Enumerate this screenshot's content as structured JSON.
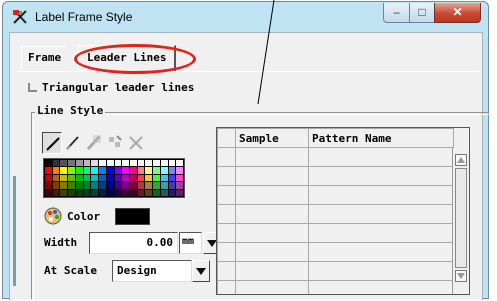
{
  "window": {
    "title": "Label Frame Style",
    "controls": {
      "minimize": "–",
      "maximize": "□",
      "close": "✕"
    }
  },
  "tabs": [
    {
      "label": "Frame"
    },
    {
      "label": "Leader Lines",
      "active": true
    }
  ],
  "options": {
    "triangular_leader_lines": {
      "label": "Triangular leader lines",
      "checked": false
    }
  },
  "line_style": {
    "legend": "Line Style",
    "tools": [
      "solid-line-icon",
      "pen-line-icon",
      "pattern-fill-icon",
      "symbol-line-icon",
      "none-icon"
    ],
    "palette": [
      [
        "#000000",
        "#333333",
        "#555555",
        "#777777",
        "#999999",
        "#bbbbbb",
        "#dddddd",
        "#ffffff",
        "#ffffff",
        "#ffffff",
        "#ffffff",
        "#ffffff",
        "#ffffff",
        "#ffffff",
        "#ffffff",
        "#ffffff",
        "#ffffff",
        "#ffffff"
      ],
      [
        "#ff0000",
        "#ff8000",
        "#ffff00",
        "#80ff00",
        "#00ff00",
        "#00ff80",
        "#00ffff",
        "#0080ff",
        "#0000ff",
        "#8000ff",
        "#ff00ff",
        "#ff0080",
        "#ff8080",
        "#ffff80",
        "#80ff80",
        "#80ffff",
        "#8080ff",
        "#ff80ff"
      ],
      [
        "#c00000",
        "#c06000",
        "#c0c000",
        "#60c000",
        "#00c000",
        "#00c060",
        "#00c0c0",
        "#0060c0",
        "#0000c0",
        "#6000c0",
        "#c000c0",
        "#c00060",
        "#ff4040",
        "#ffc040",
        "#40ff40",
        "#40c0ff",
        "#4040ff",
        "#ff40c0"
      ],
      [
        "#800000",
        "#804000",
        "#808000",
        "#408000",
        "#008000",
        "#008040",
        "#008080",
        "#004080",
        "#000080",
        "#400080",
        "#800080",
        "#800040",
        "#a04040",
        "#a08040",
        "#40a040",
        "#40a0a0",
        "#4040a0",
        "#a040a0"
      ],
      [
        "#400000",
        "#402000",
        "#404000",
        "#204000",
        "#004000",
        "#004020",
        "#004040",
        "#002040",
        "#000040",
        "#200040",
        "#400040",
        "#400020",
        "#602020",
        "#604020",
        "#206020",
        "#206060",
        "#202060",
        "#602060"
      ]
    ],
    "color": {
      "label": "Color",
      "value": "#000000"
    },
    "width": {
      "label": "Width",
      "value": "0.00",
      "unit": "mm"
    },
    "at_scale": {
      "label": "At Scale",
      "value": "Design"
    }
  },
  "pattern_table": {
    "columns": [
      "",
      "Sample",
      "Pattern Name"
    ],
    "rows": [
      [
        "",
        "",
        ""
      ],
      [
        "",
        "",
        ""
      ],
      [
        "",
        "",
        ""
      ],
      [
        "",
        "",
        ""
      ],
      [
        "",
        "",
        ""
      ],
      [
        "",
        "",
        ""
      ],
      [
        "",
        "",
        ""
      ],
      [
        "",
        "",
        ""
      ]
    ]
  },
  "annotation": {
    "highlight_color": "#e32219"
  }
}
